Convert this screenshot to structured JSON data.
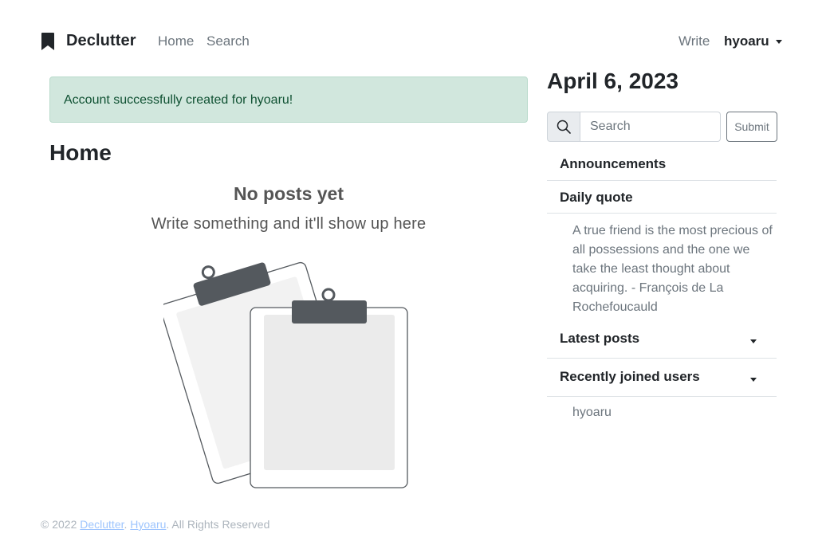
{
  "navbar": {
    "brand": "Declutter",
    "brand_icon": "bookmark-icon",
    "links": {
      "home": "Home",
      "search": "Search",
      "write": "Write"
    },
    "user": "hyoaru"
  },
  "alert": {
    "message": "Account successfully created for hyoaru!",
    "color": "#d1e7dd"
  },
  "main": {
    "title": "Home",
    "empty_title": "No posts yet",
    "empty_subtitle": "Write something and it'll show up here",
    "illustration_icon": "empty-clipboards-illustration"
  },
  "sidebar": {
    "date": "April 6, 2023",
    "search": {
      "placeholder": "Search",
      "value": "",
      "submit_label": "Submit",
      "icon": "search-icon"
    },
    "sections": {
      "announcements": "Announcements",
      "daily_quote": "Daily quote",
      "quote_text": "A true friend is the most precious of all possessions and the one we take the least thought about acquiring. - François de La Rochefoucauld",
      "latest_posts": "Latest posts",
      "recent_users": "Recently joined users",
      "users": [
        "hyoaru"
      ]
    }
  },
  "footer": {
    "prefix": "© 2022 ",
    "link1": "Declutter",
    "sep": ". ",
    "link2": "Hyoaru",
    "suffix": ". All Rights Reserved"
  }
}
